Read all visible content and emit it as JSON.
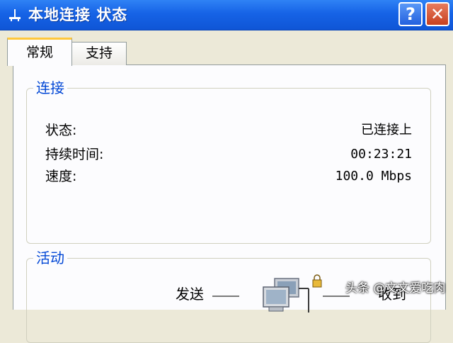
{
  "window": {
    "title": "本地连接 状态",
    "help_label": "?",
    "close_label": "✕"
  },
  "tabs": [
    {
      "label": "常规",
      "active": true
    },
    {
      "label": "支持",
      "active": false
    }
  ],
  "connection": {
    "group_title": "连接",
    "rows": [
      {
        "label": "状态:",
        "value": "已连接上"
      },
      {
        "label": "持续时间:",
        "value": "00:23:21"
      },
      {
        "label": "速度:",
        "value": "100.0 Mbps"
      }
    ]
  },
  "activity": {
    "group_title": "活动",
    "sent_label": "发送",
    "received_label": "收到"
  },
  "watermark": "头条 @文文爱吃肉",
  "colors": {
    "titlebar": "#1663e6",
    "group_title": "#0046d5",
    "active_tab_accent": "#ffc83c",
    "close_button": "#c8401f",
    "dialog_bg": "#ece9d8"
  },
  "icons": {
    "title": "network-connection-icon",
    "activity": "network-computers-icon"
  }
}
